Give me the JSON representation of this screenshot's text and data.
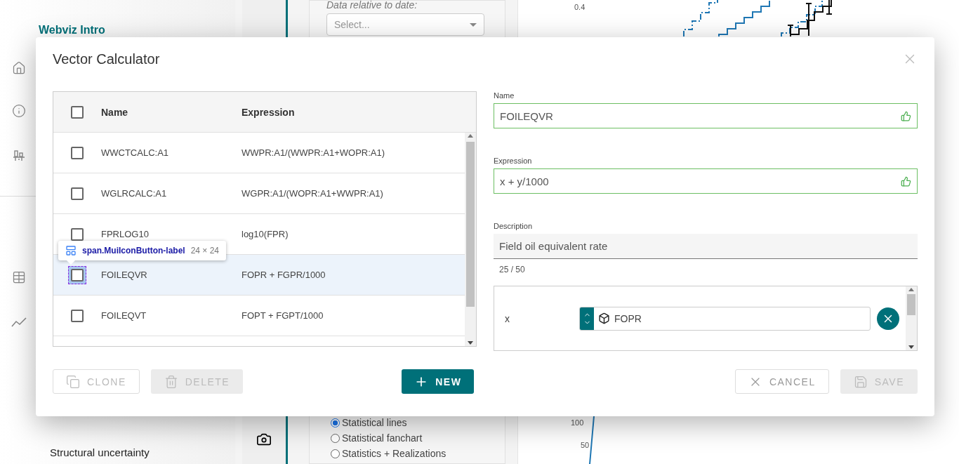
{
  "sidebar": {
    "title": "Webviz Intro",
    "items": [
      {
        "label": "Structural uncertainty"
      }
    ]
  },
  "settings": {
    "date_label": "Data relative to date:",
    "date_select": {
      "placeholder": "Select..."
    },
    "statistics_options": [
      {
        "label": "Statistical lines",
        "selected": true
      },
      {
        "label": "Statistical fanchart",
        "selected": false
      },
      {
        "label": "Statistics + Realizations",
        "selected": false
      }
    ]
  },
  "chart": {
    "y_tick_labels": [
      "0.4",
      "100",
      "50"
    ]
  },
  "dialog": {
    "title": "Vector Calculator",
    "table": {
      "columns": [
        "Name",
        "Expression"
      ],
      "header_checked": false,
      "rows": [
        {
          "name": "WWCTCALC:A1",
          "expression": "WWPR:A1/(WWPR:A1+WOPR:A1)",
          "checked": false,
          "selected": false,
          "inspected": false
        },
        {
          "name": "WGLRCALC:A1",
          "expression": "WGPR:A1/(WOPR:A1+WWPR:A1)",
          "checked": false,
          "selected": false,
          "inspected": false
        },
        {
          "name": "FPRLOG10",
          "expression": "log10(FPR)",
          "checked": false,
          "selected": false,
          "inspected": false
        },
        {
          "name": "FOILEQVR",
          "expression": "FOPR + FGPR/1000",
          "checked": false,
          "selected": true,
          "inspected": true
        },
        {
          "name": "FOILEQVT",
          "expression": "FOPT + FGPT/1000",
          "checked": false,
          "selected": false,
          "inspected": false
        }
      ]
    },
    "inspector_tooltip": {
      "selector": "span.MuiIconButton-label",
      "size": "24 × 24"
    },
    "name_field": {
      "label": "Name",
      "value": "FOILEQVR",
      "valid": true
    },
    "expression_field": {
      "label": "Expression",
      "value": "x + y/1000",
      "valid": true
    },
    "description_field": {
      "label": "Description",
      "value": "Field oil equivalent rate",
      "counter": "25 / 50"
    },
    "variables": [
      {
        "name": "x",
        "vector": "FOPR"
      }
    ],
    "left_buttons": [
      {
        "label": "CLONE",
        "kind": "outlined",
        "disabled": true
      },
      {
        "label": "DELETE",
        "kind": "filled",
        "disabled": true
      }
    ],
    "new_button": {
      "label": "NEW",
      "disabled": false
    },
    "right_buttons": [
      {
        "label": "CANCEL",
        "kind": "outlined",
        "disabled": false
      },
      {
        "label": "SAVE",
        "kind": "filled",
        "disabled": true
      }
    ]
  }
}
